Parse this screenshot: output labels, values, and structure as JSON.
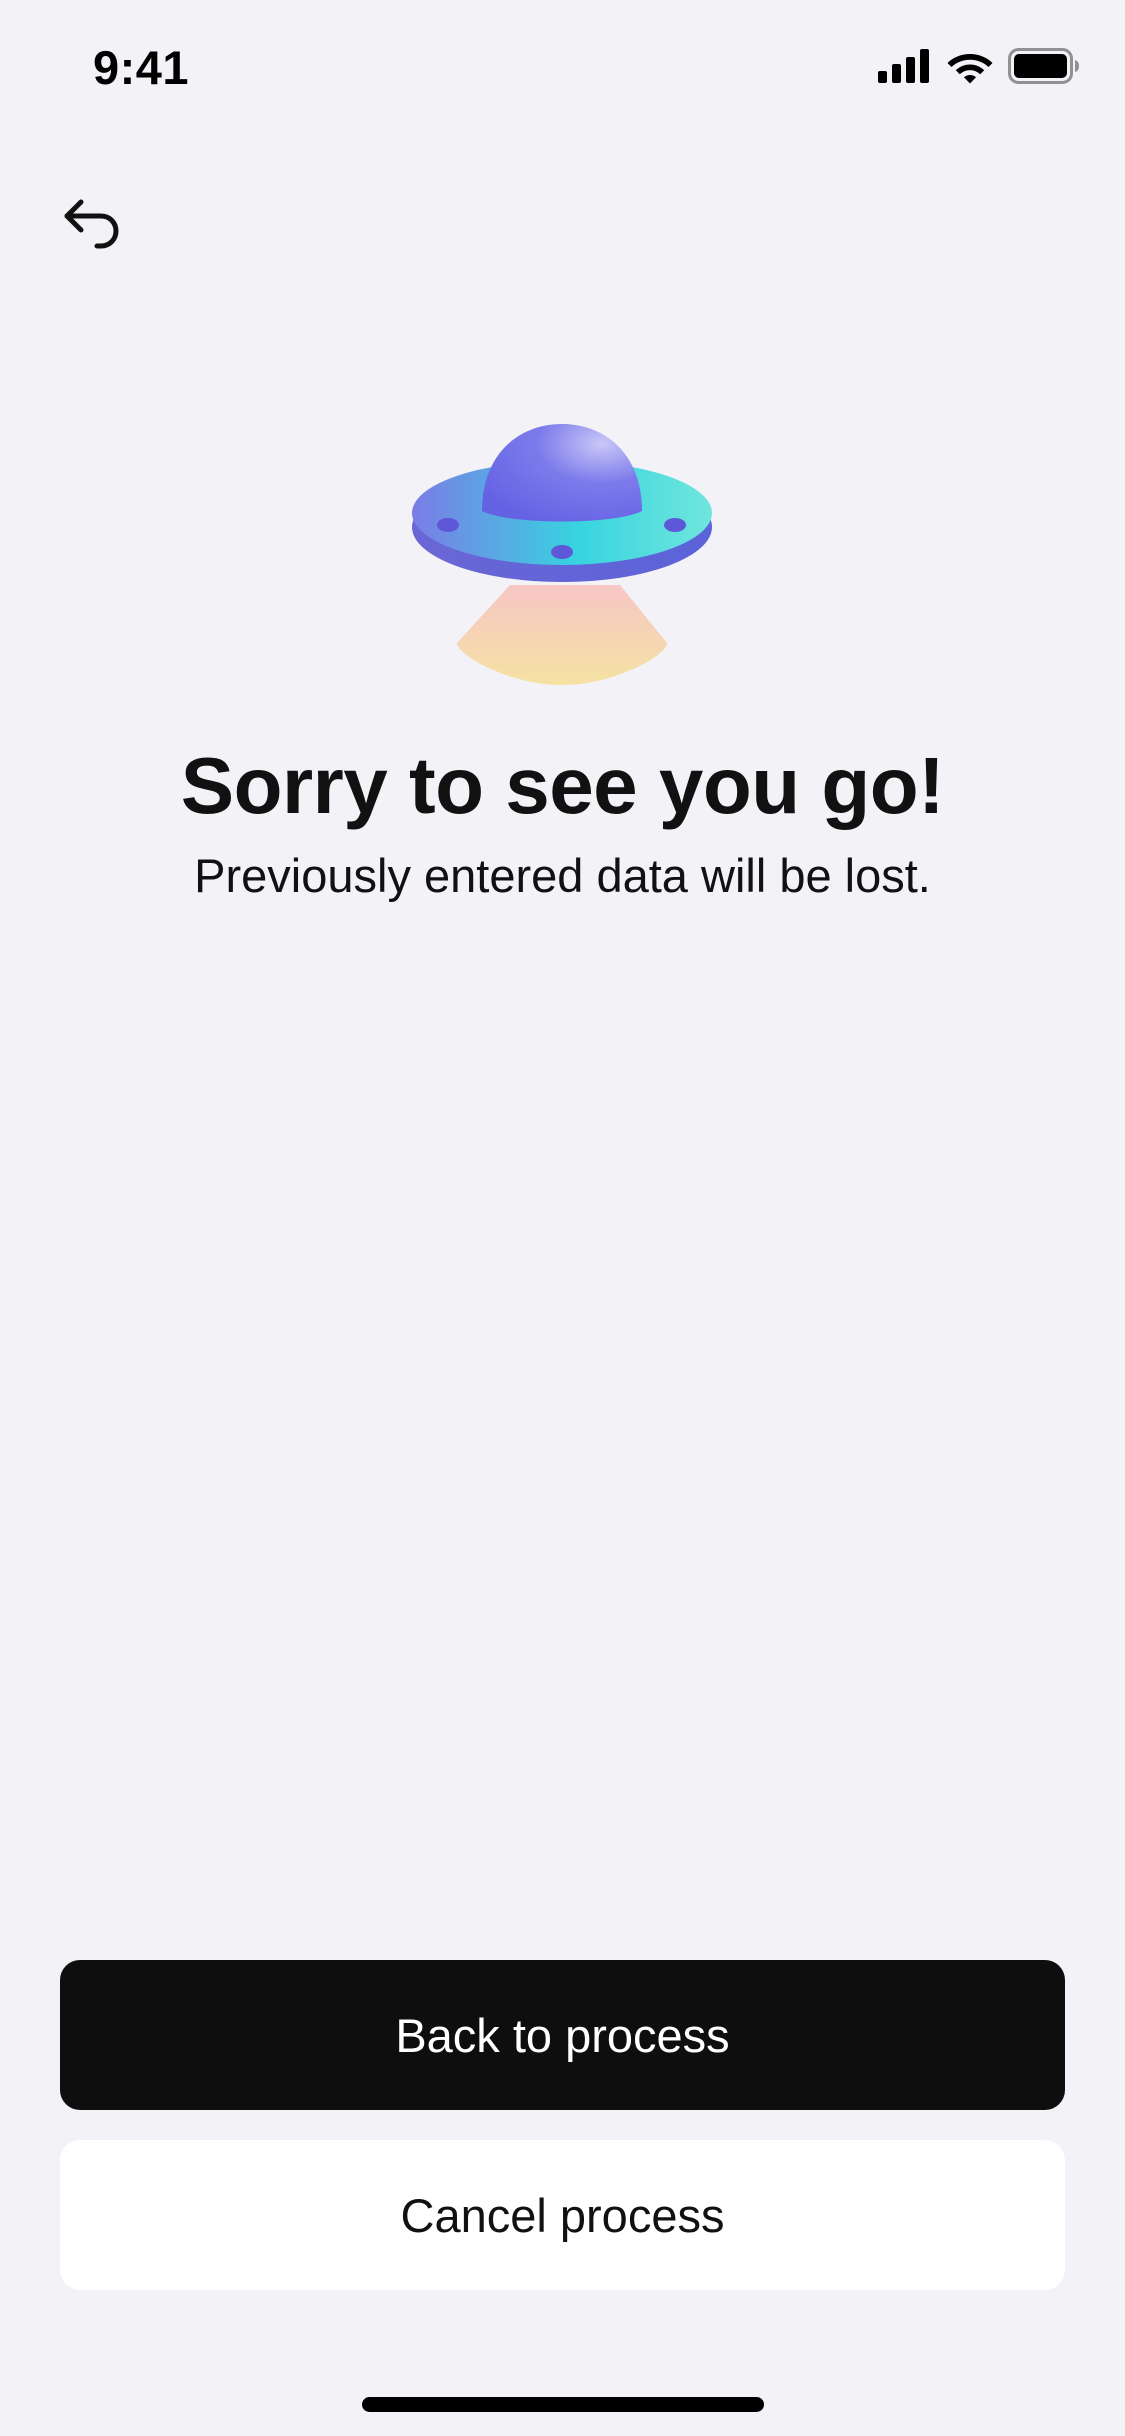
{
  "status_bar": {
    "time": "9:41",
    "signal_icon": "cellular-signal-icon",
    "wifi_icon": "wifi-icon",
    "battery_icon": "battery-icon"
  },
  "nav": {
    "back_icon": "back-arrow-icon"
  },
  "illustration": {
    "icon": "ufo-illustration",
    "colors": {
      "dome": "#6f6de8",
      "disk_left": "#7b7ce6",
      "disk_right": "#37d9df",
      "beam_top": "#f7c6c6",
      "beam_bottom": "#f5e2a2"
    }
  },
  "content": {
    "title": "Sorry to see you go!",
    "subtitle": "Previously entered data will be lost."
  },
  "actions": {
    "primary_label": "Back to process",
    "secondary_label": "Cancel process"
  }
}
